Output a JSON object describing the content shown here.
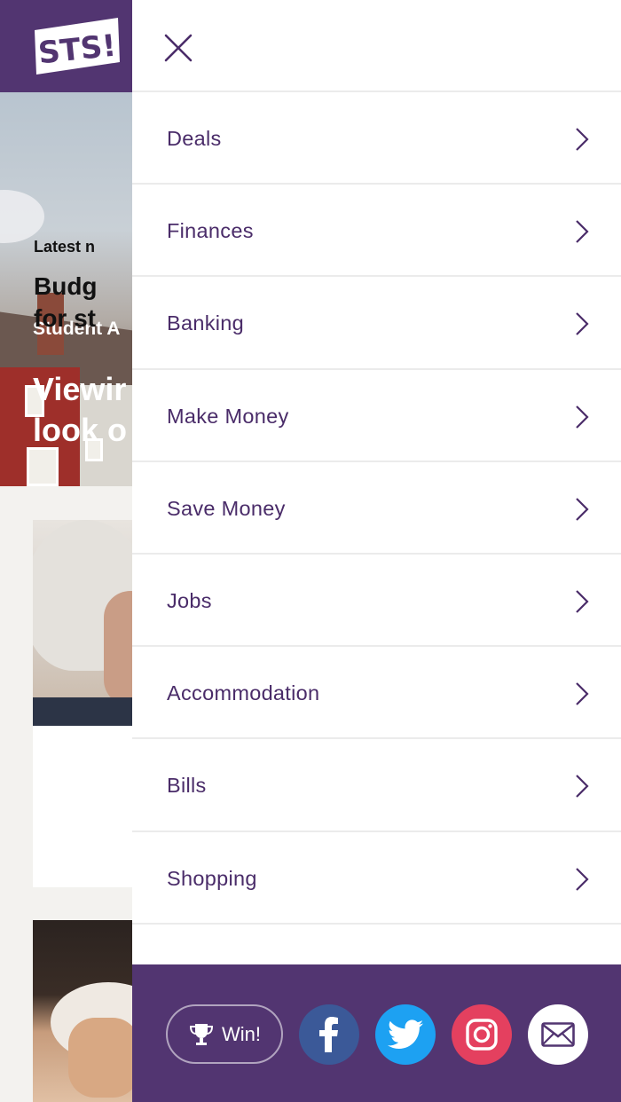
{
  "site": {
    "logo_text": "STS!"
  },
  "hero": {
    "category": "Student A",
    "title_line1": "Viewir",
    "title_line2": "look o"
  },
  "card": {
    "category": "Latest n",
    "title_line1": "Budg",
    "title_line2": "for st"
  },
  "menu": {
    "items": [
      {
        "label": "Deals"
      },
      {
        "label": "Finances"
      },
      {
        "label": "Banking"
      },
      {
        "label": "Make Money"
      },
      {
        "label": "Save Money"
      },
      {
        "label": "Jobs"
      },
      {
        "label": "Accommodation"
      },
      {
        "label": "Bills"
      },
      {
        "label": "Shopping"
      }
    ]
  },
  "footer": {
    "win_label": "Win!",
    "social": [
      "facebook-icon",
      "twitter-icon",
      "instagram-icon",
      "email-icon"
    ]
  },
  "colors": {
    "brand_purple": "#523571",
    "menu_text": "#4a2c69",
    "facebook": "#3b5998",
    "twitter": "#1da1f2",
    "instagram": "#e4405f"
  }
}
